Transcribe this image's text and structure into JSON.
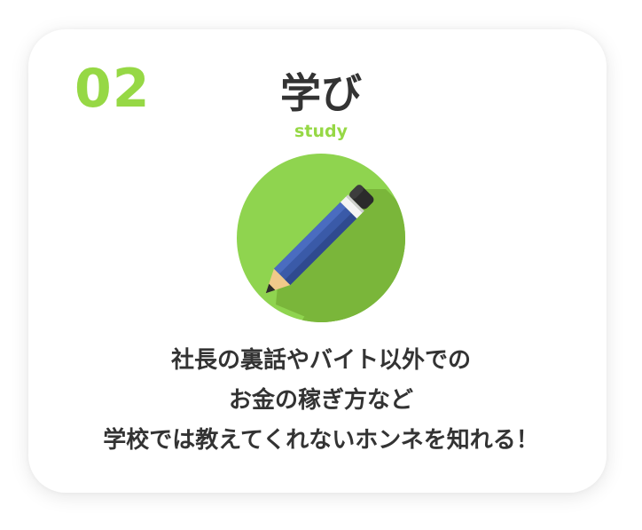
{
  "card": {
    "number": "02",
    "title": "学び",
    "subtitle": "study",
    "icon": "pencil-icon",
    "description_lines": [
      "社長の裏話やバイト以外での",
      "お金の稼ぎ方など",
      "学校では教えてくれないホンネを知れる！"
    ]
  },
  "colors": {
    "accent": "#96d845",
    "text": "#333333",
    "circle": "#8fd44f",
    "circle_shadow": "#7ab63a",
    "pencil_body": "#3a5aa8",
    "pencil_wood": "#f0c98a",
    "eraser": "#2b2b2b"
  }
}
